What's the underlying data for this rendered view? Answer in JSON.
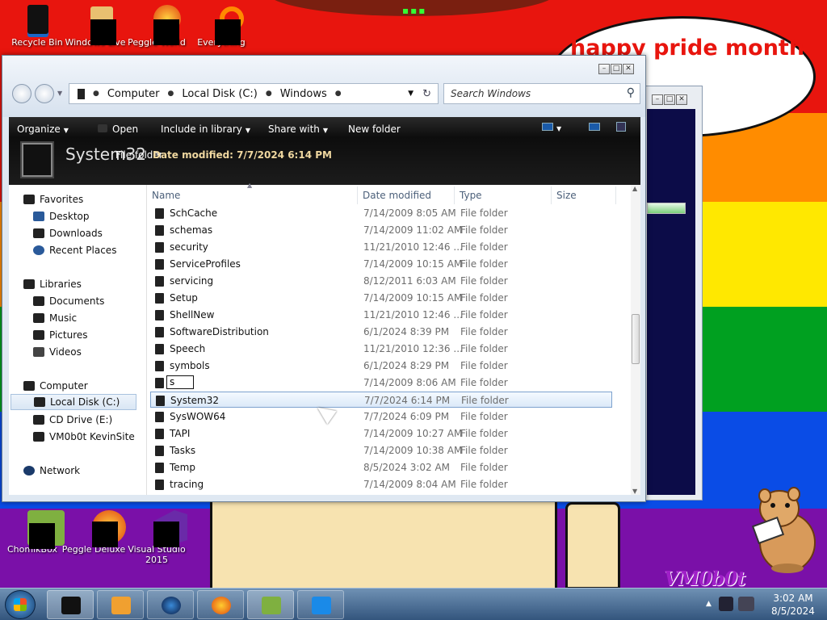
{
  "desktop": {
    "bubble_text": "happy pride month",
    "logo_text": "VM0b0t",
    "icons_top": [
      "Recycle Bin",
      "Windows Live",
      "Peggle World",
      "Everything"
    ],
    "icons_bottom": [
      "ChomikBox",
      "Peggle Deluxe",
      "Visual Studio 2015"
    ]
  },
  "explorer": {
    "breadcrumbs": [
      "Computer",
      "Local Disk (C:)",
      "Windows"
    ],
    "search_placeholder": "Search Windows",
    "toolbar": {
      "organize": "Organize",
      "open": "Open",
      "include_in_library": "Include in library",
      "share_with": "Share with",
      "new_folder": "New folder"
    },
    "details": {
      "name": "System32",
      "type": "File folder",
      "date": "Date modified: 7/7/2024 6:14 PM"
    },
    "nav": {
      "favorites": "Favorites",
      "desktop": "Desktop",
      "downloads": "Downloads",
      "recent_places": "Recent Places",
      "libraries": "Libraries",
      "documents": "Documents",
      "music": "Music",
      "pictures": "Pictures",
      "videos": "Videos",
      "computer": "Computer",
      "local_disk": "Local Disk (C:)",
      "cd_drive": "CD Drive (E:)",
      "vm0b0t": "VM0b0t KevinSite",
      "network": "Network"
    },
    "columns": {
      "name": "Name",
      "date": "Date modified",
      "type": "Type",
      "size": "Size"
    },
    "rename_text": "s",
    "files": [
      {
        "name": "SchCache",
        "date": "7/14/2009 8:05 AM",
        "type": "File folder"
      },
      {
        "name": "schemas",
        "date": "7/14/2009 11:02 AM",
        "type": "File folder"
      },
      {
        "name": "security",
        "date": "11/21/2010 12:46 ...",
        "type": "File folder"
      },
      {
        "name": "ServiceProfiles",
        "date": "7/14/2009 10:15 AM",
        "type": "File folder"
      },
      {
        "name": "servicing",
        "date": "8/12/2011 6:03 AM",
        "type": "File folder"
      },
      {
        "name": "Setup",
        "date": "7/14/2009 10:15 AM",
        "type": "File folder"
      },
      {
        "name": "ShellNew",
        "date": "11/21/2010 12:46 ...",
        "type": "File folder"
      },
      {
        "name": "SoftwareDistribution",
        "date": "6/1/2024 8:39 PM",
        "type": "File folder"
      },
      {
        "name": "Speech",
        "date": "11/21/2010 12:36 ...",
        "type": "File folder"
      },
      {
        "name": "symbols",
        "date": "6/1/2024 8:29 PM",
        "type": "File folder"
      },
      {
        "name": "",
        "date": "7/14/2009 8:06 AM",
        "type": "File folder"
      },
      {
        "name": "System32",
        "date": "7/7/2024 6:14 PM",
        "type": "File folder"
      },
      {
        "name": "SysWOW64",
        "date": "7/7/2024 6:09 PM",
        "type": "File folder"
      },
      {
        "name": "TAPI",
        "date": "7/14/2009 10:27 AM",
        "type": "File folder"
      },
      {
        "name": "Tasks",
        "date": "7/14/2009 10:38 AM",
        "type": "File folder"
      },
      {
        "name": "Temp",
        "date": "8/5/2024 3:02 AM",
        "type": "File folder"
      },
      {
        "name": "tracing",
        "date": "7/14/2009 8:04 AM",
        "type": "File folder"
      }
    ]
  },
  "taskbar": {
    "time": "3:02 AM",
    "date": "8/5/2024"
  },
  "colors": {
    "selection_border": "#7da2ce",
    "toolbar_bg": "#1c1c1c",
    "bubble_text": "#e8150e"
  }
}
